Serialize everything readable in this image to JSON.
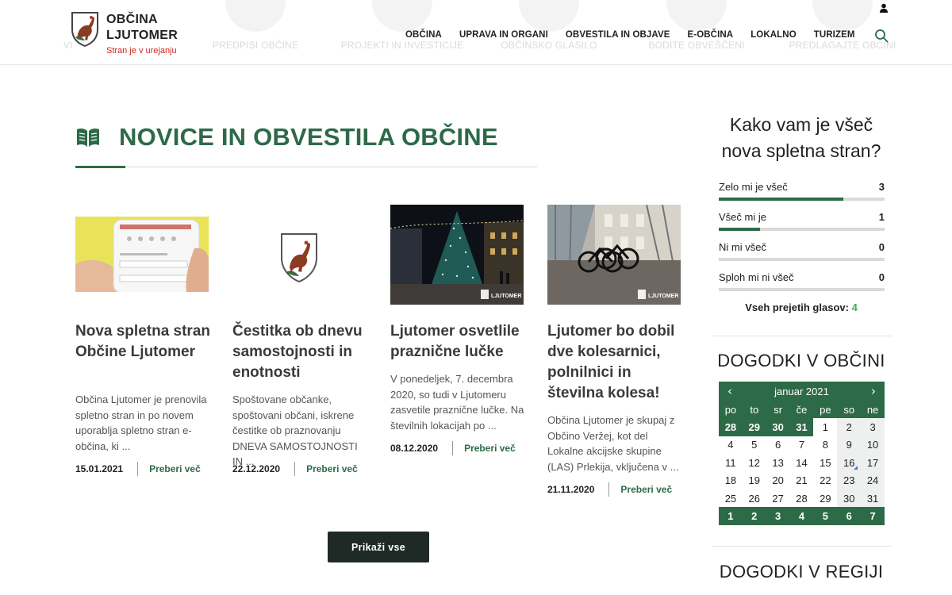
{
  "header": {
    "ghost_labels": [
      "VI",
      "PREDPISI OBČINE",
      "PROJEKTI IN INVESTICIJE",
      "OBČINSKO GLASILO",
      "BODITE OBVEŠČENI",
      "PREDLAGAJTE OBČINI"
    ],
    "brand_line1": "OBČINA",
    "brand_line2": "LJUTOMER",
    "brand_tagline": "Stran je v urejanju",
    "nav": [
      "OBČINA",
      "UPRAVA IN ORGANI",
      "OBVESTILA IN OBJAVE",
      "E-OBČINA",
      "LOKALNO",
      "TURIZEM"
    ],
    "search_icon": "search-icon",
    "user_icon": "user-icon"
  },
  "news": {
    "title": "NOVICE IN OBVESTILA OBČINE",
    "icon": "open-book-icon",
    "accent_color": "#2d6a47",
    "items": [
      {
        "title": "Nova spletna stran Občine Ljutomer",
        "excerpt": "Občina Ljutomer je prenovila spletno stran in po novem uporablja spletno stran e-občina, ki ...",
        "date": "15.01.2021",
        "more": "Preberi več"
      },
      {
        "title": "Čestitka ob dnevu samostojnosti in enotnosti",
        "excerpt": "Spoštovane občanke, spoštovani občani, iskrene čestitke ob praznovanju DNEVA SAMOSTOJNOSTI IN ...",
        "date": "22.12.2020",
        "more": "Preberi več"
      },
      {
        "title": "Ljutomer osvetlile praznične lučke",
        "excerpt": "V ponedeljek, 7. decembra 2020, so tudi v Ljutomeru zasvetile praznične lučke. Na številnih lokacijah po ...",
        "date": "08.12.2020",
        "more": "Preberi več",
        "watermark": "LJUTOMER"
      },
      {
        "title": "Ljutomer bo dobil dve kolesarnici, polnilnici in številna kolesa!",
        "excerpt": "Občina Ljutomer je skupaj z Občino Veržej, kot del Lokalne akcijske skupine (LAS) Prlekija, vključena v ...",
        "date": "21.11.2020",
        "more": "Preberi več",
        "watermark": "LJUTOMER"
      }
    ],
    "show_all": "Prikaži vse"
  },
  "poll": {
    "title": "Kako vam je všeč nova spletna stran?",
    "options": [
      {
        "label": "Zelo mi je všeč",
        "count": "3",
        "share": 0.75
      },
      {
        "label": "Všeč mi je",
        "count": "1",
        "share": 0.25
      },
      {
        "label": "Ni mi všeč",
        "count": "0",
        "share": 0
      },
      {
        "label": "Sploh mi ni všeč",
        "count": "0",
        "share": 0
      }
    ],
    "total_label": "Vseh prejetih glasov:",
    "total": "4"
  },
  "events": {
    "title": "DOGODKI V OBČINI",
    "month": "januar 2021",
    "prev_icon": "chevron-left-icon",
    "next_icon": "chevron-right-icon",
    "weekdays": [
      "po",
      "to",
      "sr",
      "če",
      "pe",
      "so",
      "ne"
    ],
    "weeks": [
      [
        "28",
        "29",
        "30",
        "31",
        "1",
        "2",
        "3"
      ],
      [
        "4",
        "5",
        "6",
        "7",
        "8",
        "9",
        "10"
      ],
      [
        "11",
        "12",
        "13",
        "14",
        "15",
        "16",
        "17"
      ],
      [
        "18",
        "19",
        "20",
        "21",
        "22",
        "23",
        "24"
      ],
      [
        "25",
        "26",
        "27",
        "28",
        "29",
        "30",
        "31"
      ],
      [
        "1",
        "2",
        "3",
        "4",
        "5",
        "6",
        "7"
      ]
    ],
    "marked_day": "16"
  },
  "region": {
    "title": "DOGODKI V REGIJI"
  }
}
